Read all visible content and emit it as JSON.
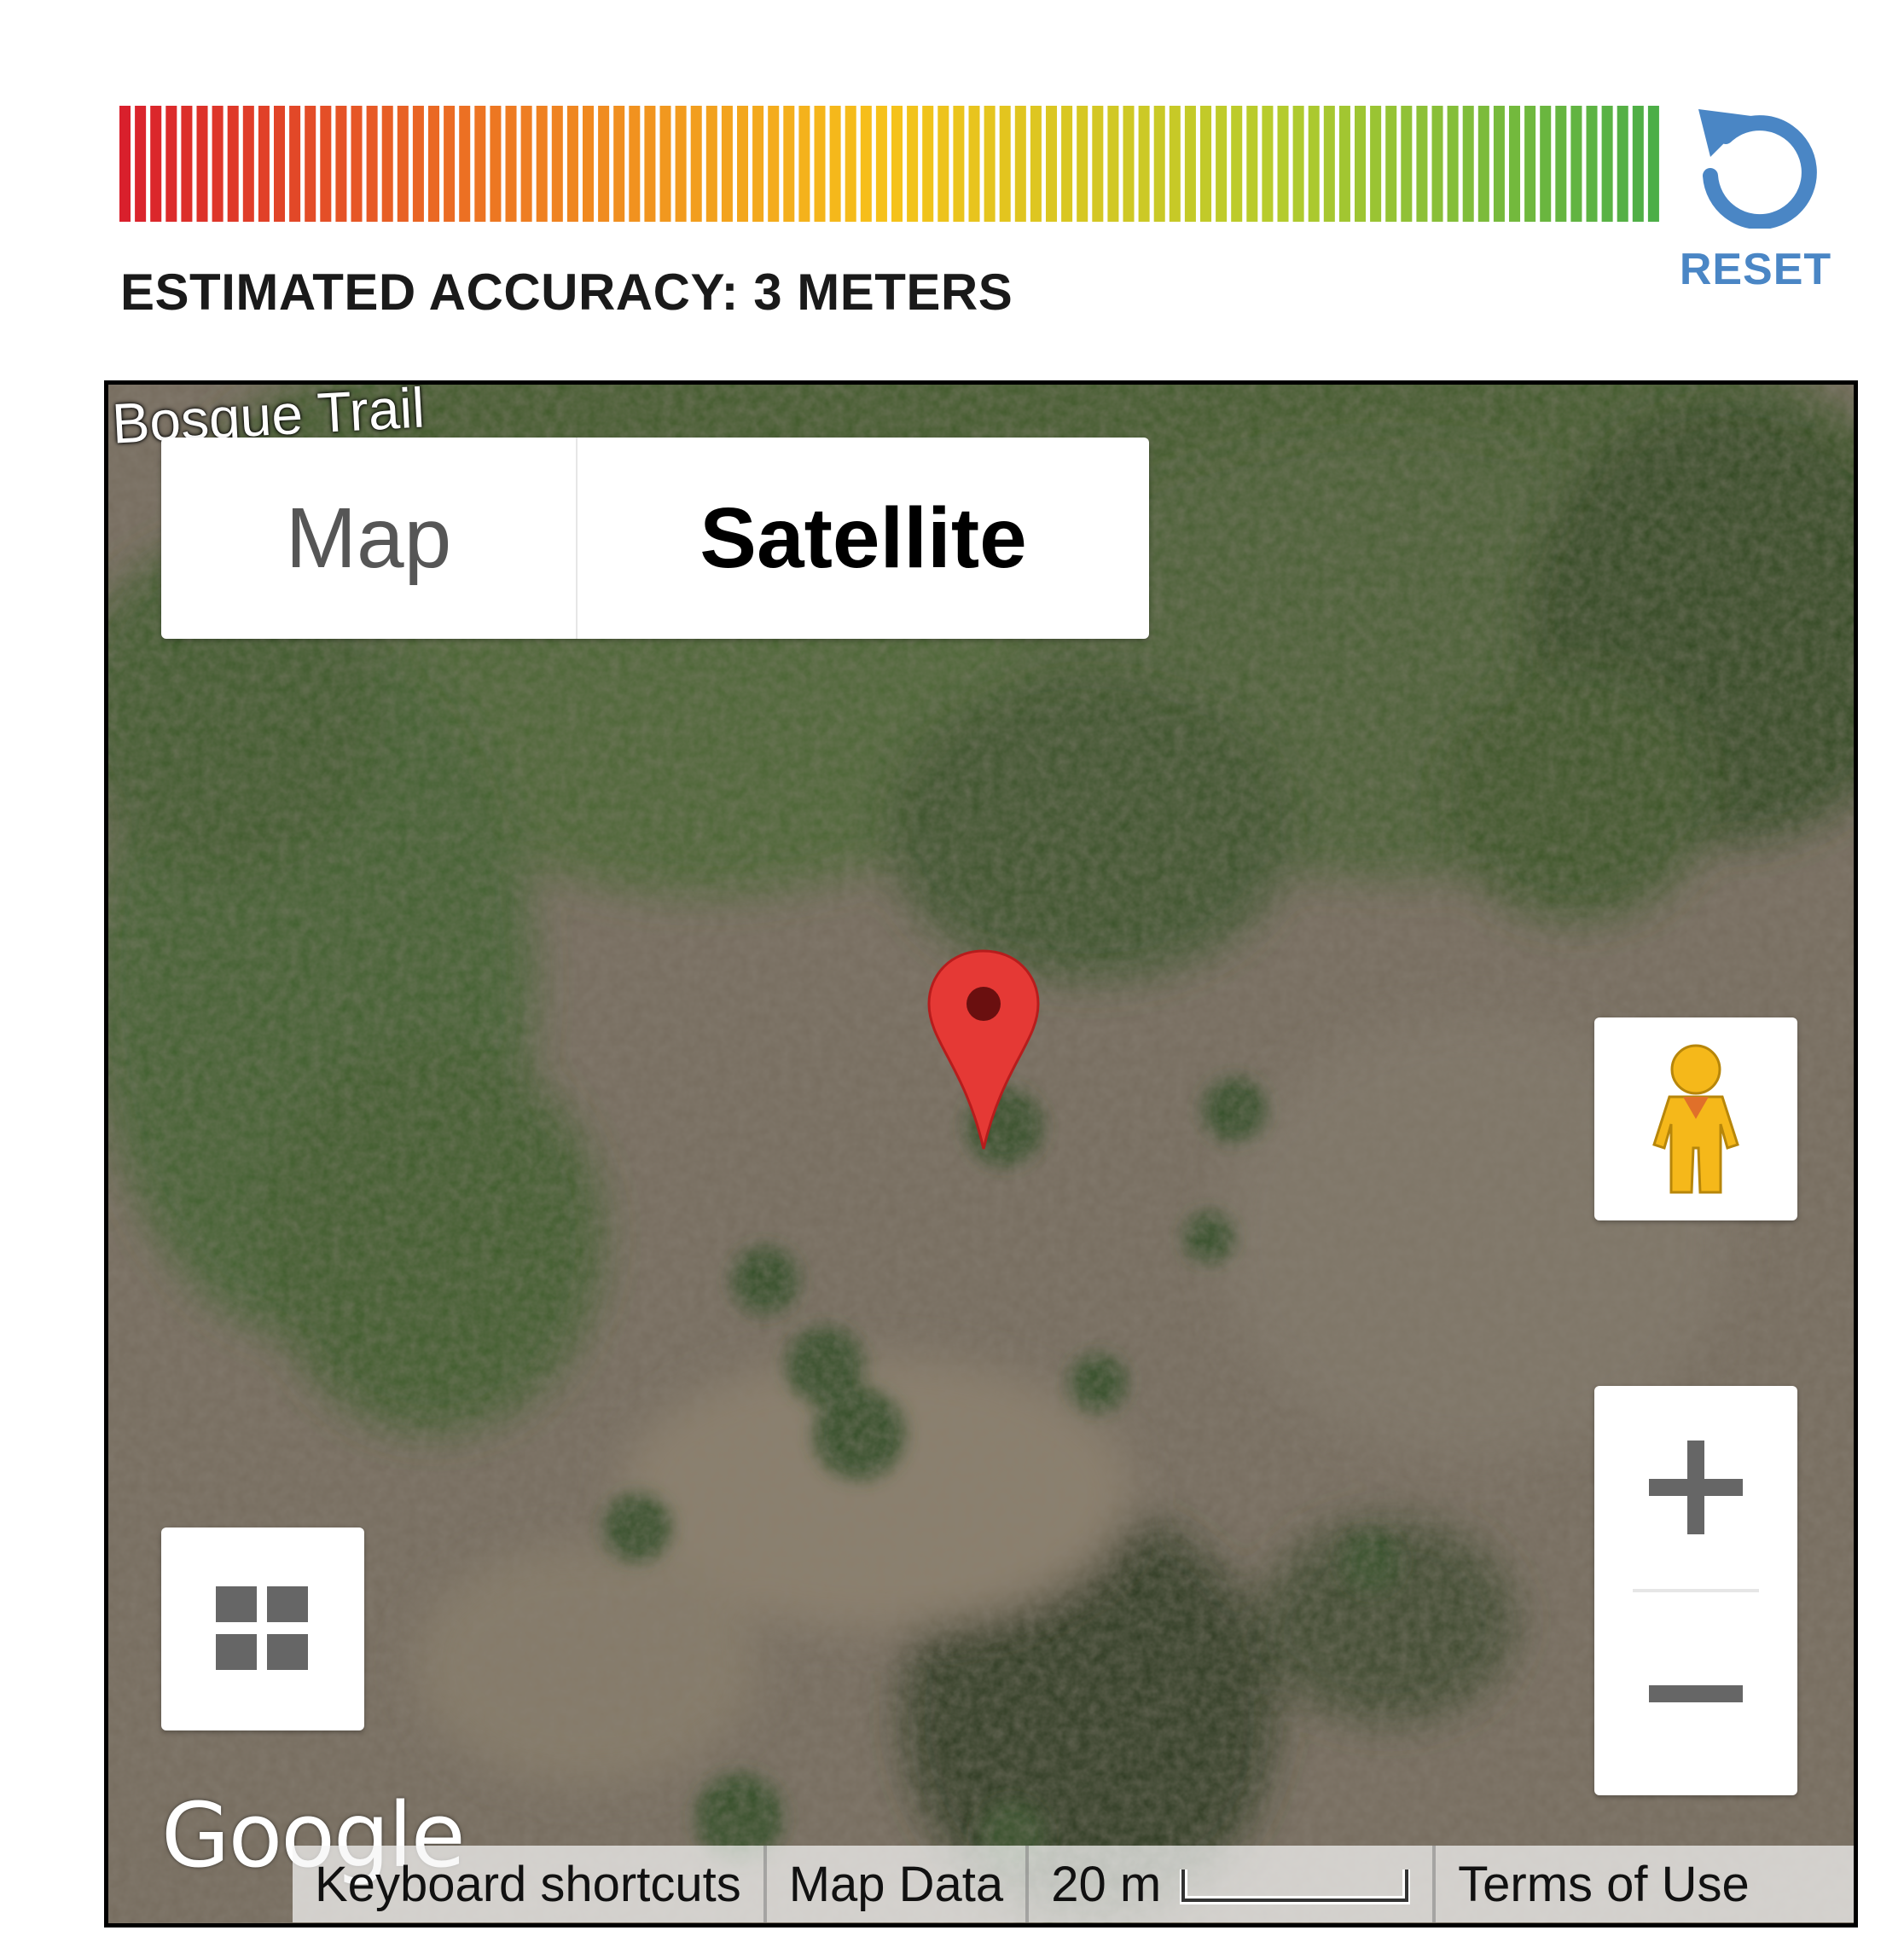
{
  "accuracy": {
    "label": "ESTIMATED ACCURACY: 3 METERS",
    "meter_level": 1.0,
    "gradient_colors": [
      "#d9202c",
      "#ee7a22",
      "#f6c21a",
      "#b7cc2c",
      "#4cae47"
    ]
  },
  "reset": {
    "label": "RESET",
    "icon": "reset-arrow-icon",
    "color": "#4a86c5"
  },
  "map": {
    "road_label": "Bosque Trail",
    "map_type": {
      "options": [
        "Map",
        "Satellite"
      ],
      "selected": "Satellite"
    },
    "marker_color": "#e53935",
    "pegman_icon": "pegman-icon",
    "zoom_in_icon": "plus-icon",
    "zoom_out_icon": "minus-icon",
    "tiles_icon": "grid-icon",
    "logo": "Google",
    "footer": {
      "keyboard_shortcuts": "Keyboard shortcuts",
      "map_data": "Map Data",
      "scale": "20 m",
      "terms": "Terms of Use"
    }
  }
}
